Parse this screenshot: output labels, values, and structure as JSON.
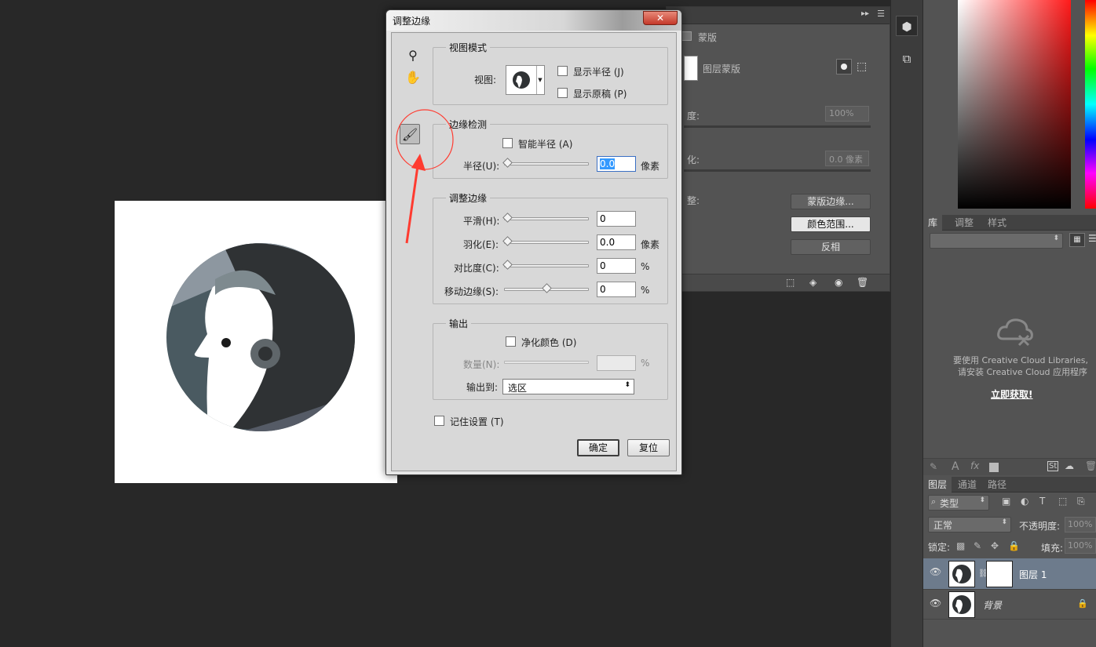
{
  "dialog": {
    "title": "调整边缘",
    "close_label": "✕",
    "view_mode": {
      "title": "视图模式",
      "view_label": "视图:",
      "show_radius": "显示半径 (J)",
      "show_original": "显示原稿 (P)"
    },
    "edge_detection": {
      "title": "边缘检测",
      "smart_radius": "智能半径 (A)",
      "radius_label": "半径(U):",
      "radius_value": "0.0",
      "radius_unit": "像素"
    },
    "adjust_edge": {
      "title": "调整边缘",
      "smooth_label": "平滑(H):",
      "smooth_value": "0",
      "feather_label": "羽化(E):",
      "feather_value": "0.0",
      "feather_unit": "像素",
      "contrast_label": "对比度(C):",
      "contrast_value": "0",
      "contrast_unit": "%",
      "shift_label": "移动边缘(S):",
      "shift_value": "0",
      "shift_unit": "%"
    },
    "output": {
      "title": "输出",
      "decontaminate": "净化颜色 (D)",
      "amount_label": "数量(N):",
      "amount_unit": "%",
      "output_to_label": "输出到:",
      "output_to_value": "选区"
    },
    "remember": "记住设置 (T)",
    "ok_label": "确定",
    "reset_label": "复位"
  },
  "properties": {
    "mask_title": "蒙版",
    "layer_mask": "图层蒙版",
    "density_label": "度:",
    "density_value": "100%",
    "feather_label": "化:",
    "feather_value": "0.0 像素",
    "refine_label": "整:",
    "mask_edge_btn": "蒙版边缘...",
    "color_range_btn": "颜色范围...",
    "invert_btn": "反相"
  },
  "library": {
    "tabs": [
      "库",
      "调整",
      "样式"
    ],
    "message_line1": "要使用 Creative Cloud Libraries,",
    "message_line2": "请安装 Creative Cloud 应用程序",
    "link": "立即获取!"
  },
  "layers": {
    "tabs": [
      "图层",
      "通道",
      "路径"
    ],
    "filter_kind": "类型",
    "blend_mode": "正常",
    "opacity_label": "不透明度:",
    "opacity_value": "100%",
    "lock_label": "锁定:",
    "fill_label": "填充:",
    "fill_value": "100%",
    "items": [
      {
        "name": "图层 1"
      },
      {
        "name": "背景"
      }
    ]
  },
  "colors": {
    "accent_selection": "#3399ff",
    "annotation_red": "#ff3b30"
  }
}
